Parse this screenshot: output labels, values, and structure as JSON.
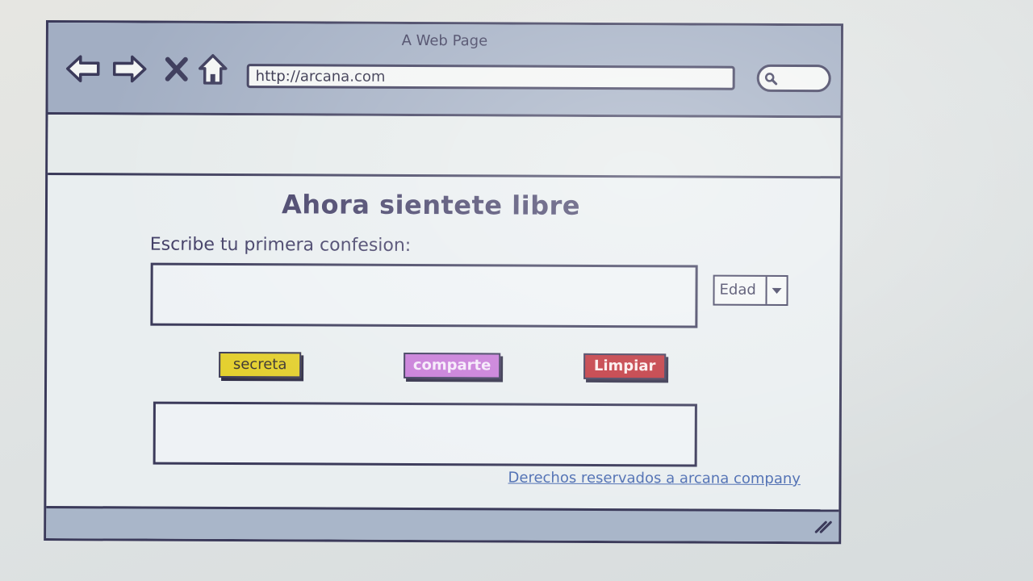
{
  "window": {
    "title": "A Web Page"
  },
  "navigation": {
    "back_icon": "back-arrow-icon",
    "forward_icon": "forward-arrow-icon",
    "stop_icon": "close-icon",
    "home_icon": "home-icon",
    "url": "http://arcana.com",
    "search_icon": "search-icon"
  },
  "main": {
    "heading": "Ahora sientete libre",
    "prompt_label": "Escribe tu primera confesion:",
    "confession_value": "",
    "age_select": {
      "selected": "Edad"
    },
    "buttons": {
      "secreta": "secreta",
      "comparte": "comparte",
      "limpiar": "Limpiar"
    },
    "result_value": "",
    "footer_link": "Derechos reservados a arcana company"
  },
  "colors": {
    "titlebar": "#a2aec3",
    "secreta_button": "#e3cf2c",
    "comparte_button": "#c77ad8",
    "limpiar_button": "#c0333b",
    "link": "#4f6fb3"
  }
}
